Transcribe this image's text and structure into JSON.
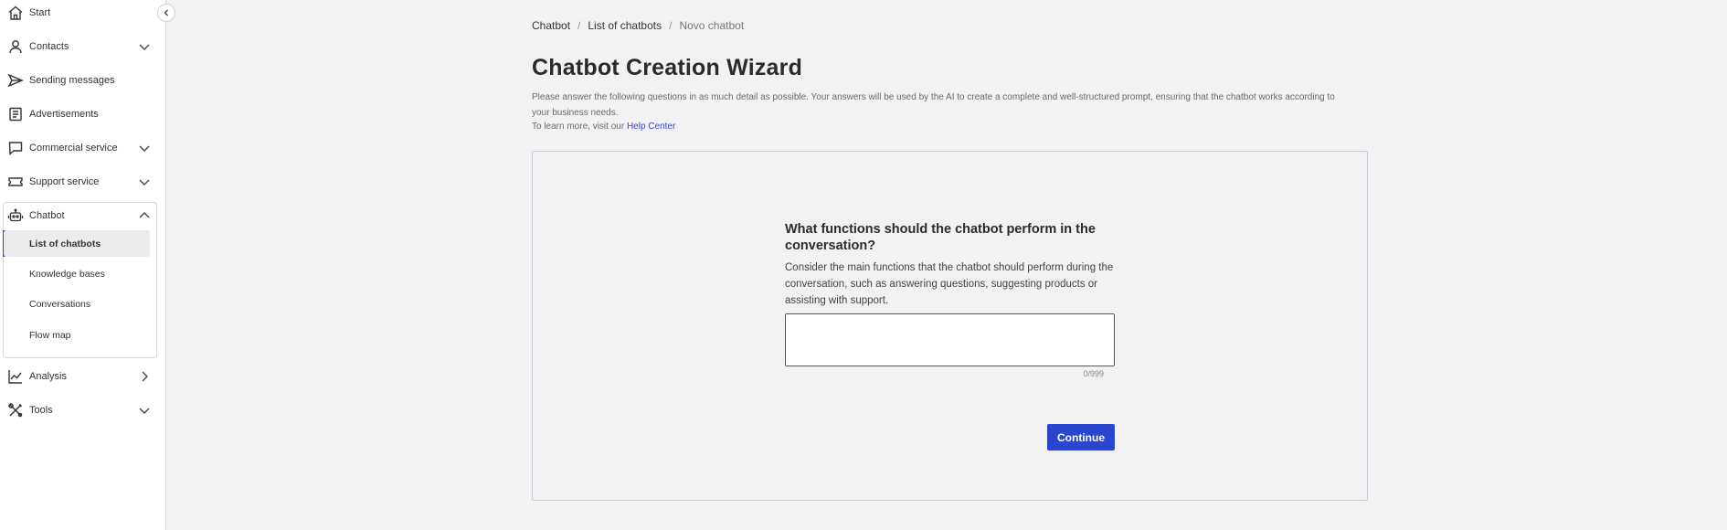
{
  "sidebar": {
    "items": [
      {
        "label": "Start",
        "icon": "home-icon",
        "chevron": null
      },
      {
        "label": "Contacts",
        "icon": "user-icon",
        "chevron": "down"
      },
      {
        "label": "Sending messages",
        "icon": "send-icon",
        "chevron": null
      },
      {
        "label": "Advertisements",
        "icon": "document-icon",
        "chevron": null
      },
      {
        "label": "Commercial service",
        "icon": "chat-bubble-icon",
        "chevron": "down"
      },
      {
        "label": "Support service",
        "icon": "ticket-icon",
        "chevron": "down"
      },
      {
        "label": "Chatbot",
        "icon": "robot-icon",
        "chevron": "up"
      },
      {
        "label": "Analysis",
        "icon": "chart-line-icon",
        "chevron": "right"
      },
      {
        "label": "Tools",
        "icon": "tools-icon",
        "chevron": "down"
      }
    ],
    "chatbot_subitems": [
      {
        "label": "List of chatbots",
        "active": true
      },
      {
        "label": "Knowledge bases",
        "active": false
      },
      {
        "label": "Conversations",
        "active": false
      },
      {
        "label": "Flow map",
        "active": false
      }
    ],
    "accent_color": "#4a3dd1"
  },
  "breadcrumb": {
    "items": [
      "Chatbot",
      "List of chatbots"
    ],
    "current": "Novo chatbot",
    "separator": "/"
  },
  "page": {
    "title": "Chatbot Creation Wizard",
    "intro": "Please answer the following questions in as much detail as possible. Your answers will be used by the AI to create a complete and well-structured prompt, ensuring that the chatbot works according to your business needs.",
    "help_prefix": "To learn more, visit our ",
    "help_link": "Help Center"
  },
  "question": {
    "title": "What functions should the chatbot perform in the conversation?",
    "description": "Consider the main functions that the chatbot should perform during the conversation, such as answering questions, suggesting products or assisting with support.",
    "value": "",
    "counter": "0/999"
  },
  "actions": {
    "continue_label": "Continue",
    "continue_color": "#2a45cf"
  }
}
